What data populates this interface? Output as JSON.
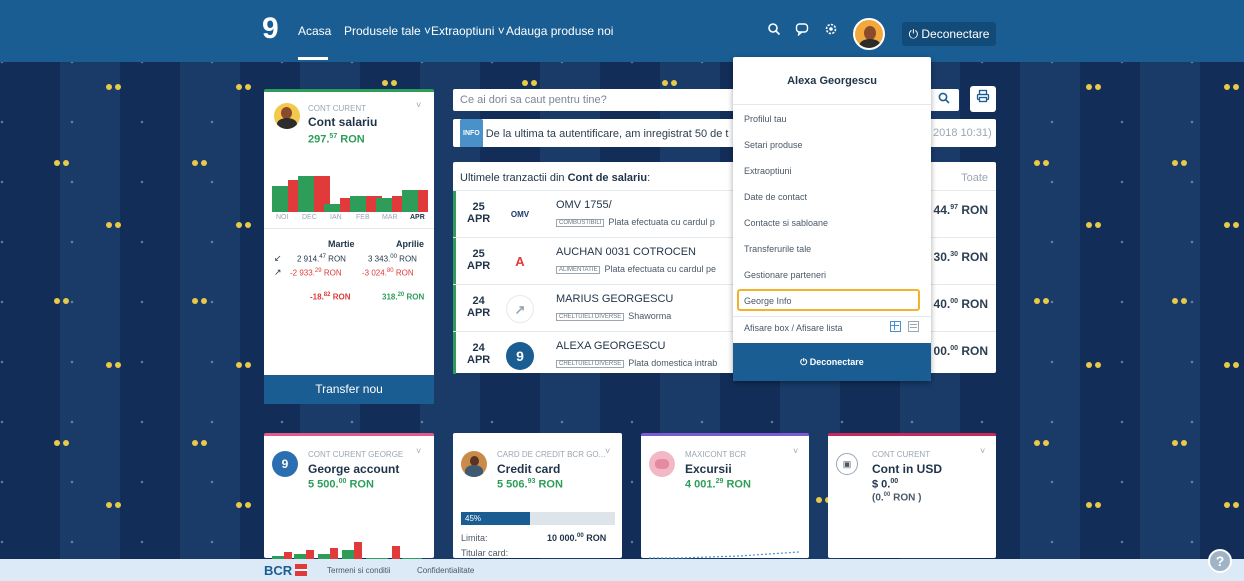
{
  "topbar": {
    "logo": "9",
    "nav": [
      "Acasa",
      "Produsele tale ˅",
      "Extraoptiuni ˅",
      "Adauga produse noi"
    ],
    "logout": "⏻ Deconectare"
  },
  "icons": [
    "search-icon",
    "chat-icon",
    "gear-icon"
  ],
  "salary_card": {
    "type": "CONT CURENT",
    "title": "Cont salariu",
    "amount_int": "297.",
    "amount_dec": "57",
    "currency": " RON",
    "months": [
      "NOI",
      "DEC",
      "IAN",
      "FEB",
      "MAR",
      "APR"
    ],
    "col1": "Martie",
    "col2": "Aprilie",
    "in1_int": "2 914.",
    "in1_dec": "47",
    "in2_int": "3 343.",
    "in2_dec": "00",
    "out1_int": "-2 933.",
    "out1_dec": "29",
    "out2_int": "-3 024.",
    "out2_dec": "80",
    "net1_int": "-18.",
    "net1_dec": "82",
    "net2_int": "318.",
    "net2_dec": "20",
    "ron": " RON",
    "transfer": "Transfer nou"
  },
  "search": {
    "placeholder": "Ce ai dori sa caut pentru tine?"
  },
  "info": {
    "tag": "INFO",
    "text": "De la ultima ta autentificare, am inregistrat 50 de t",
    "date": "2018 10:31)"
  },
  "transactions": {
    "head_prefix": "Ultimele tranzactii din ",
    "head_bold": "Cont de salariu",
    "head_colon": ":",
    "all": "Toate",
    "rows": [
      {
        "day": "25",
        "mon": "APR",
        "logo": "OMV",
        "name": "OMV 1755/",
        "tag": "COMBUSTIBILI",
        "desc": "Plata efectuata cu cardul p",
        "amt": "44.",
        "dec": "97",
        "ron": " RON"
      },
      {
        "day": "25",
        "mon": "APR",
        "logo": "A",
        "name": "AUCHAN 0031 COTROCEN",
        "tag": "ALIMENTATIE",
        "desc": "Plata efectuata cu cardul pe",
        "amt": "30.",
        "dec": "30",
        "ron": " RON"
      },
      {
        "day": "24",
        "mon": "APR",
        "logo": "↗",
        "name": "MARIUS GEORGESCU",
        "tag": "CHELTUIELI DIVERSE",
        "desc": "Shaworma",
        "amt": "40.",
        "dec": "00",
        "ron": " RON"
      },
      {
        "day": "24",
        "mon": "APR",
        "logo": "9",
        "name": "ALEXA GEORGESCU",
        "tag": "CHELTUIELI DIVERSE",
        "desc": "Plata domestica intrab",
        "amt": "00.",
        "dec": "00",
        "ron": " RON"
      }
    ]
  },
  "dropdown": {
    "name": "Alexa Georgescu",
    "items": [
      "Profilul tau",
      "Setari produse",
      "Extraoptiuni",
      "Date de contact",
      "Contacte si sabloane",
      "Transferurile tale",
      "Gestionare parteneri",
      "George Info"
    ],
    "view_toggle": "Afisare box / Afisare lista",
    "logout": "⏻ Deconectare"
  },
  "bottom_cards": [
    {
      "type": "CONT CURENT GEORGE",
      "title": "George account",
      "amt": "5 500.",
      "dec": "00",
      "ron": " RON"
    },
    {
      "type": "CARD DE CREDIT BCR GO...",
      "title": "Credit card",
      "amt": "5 506.",
      "dec": "93",
      "ron": " RON",
      "progress_label": "45%",
      "progress": 0.45,
      "limit_label": "Limita:",
      "limit_amt": "10 000.",
      "limit_dec": "00",
      "limit_ron": " RON",
      "holder_label": "Titular card:"
    },
    {
      "type": "MAXICONT BCR",
      "title": "Excursii",
      "amt": "4 001.",
      "dec": "29",
      "ron": " RON"
    },
    {
      "type": "CONT CURENT",
      "title": "Cont in USD",
      "amt": "$ 0.",
      "dec": "00",
      "sub_open": "(0.",
      "sub_dec": "00",
      "sub_close": " RON )"
    }
  ],
  "footer": {
    "brand": "BCR",
    "links": [
      "Termeni si conditii",
      "Confidentialitate"
    ],
    "help": "?"
  }
}
